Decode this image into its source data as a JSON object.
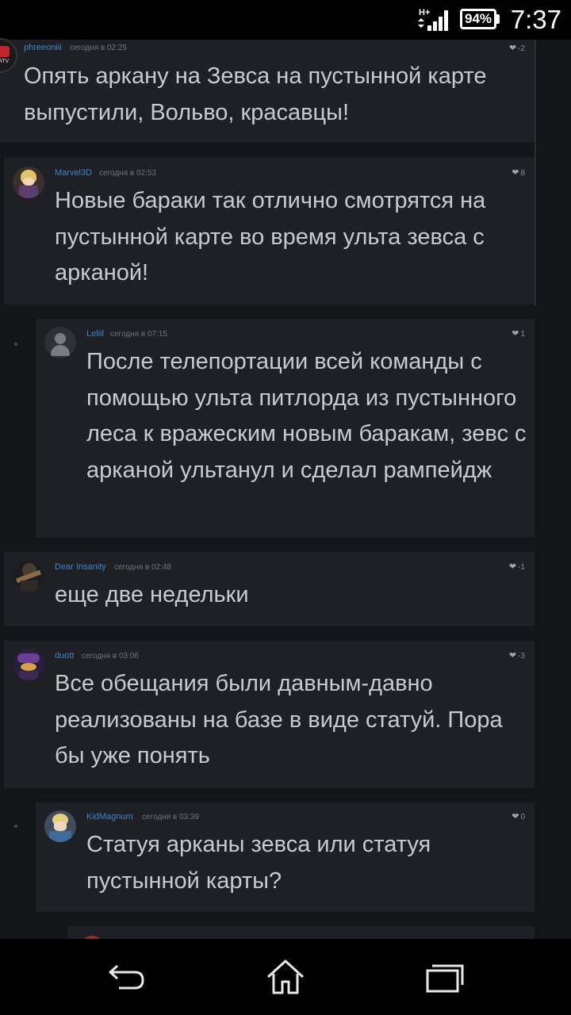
{
  "status_bar": {
    "network": "H+",
    "battery": "94%",
    "time": "7:37"
  },
  "comments": [
    {
      "author": "phreeoniii",
      "date": "сегодня в 02:25",
      "likes": "-2",
      "text": "Опять аркану на Зевса на пустынной карте выпустили, Вольво, красавцы!"
    },
    {
      "author": "Marvel3D",
      "date": "сегодня в 02:53",
      "likes": "8",
      "text": "Новые бараки так отлично смотрятся на пустынной карте во время ульта зевса с арканой!"
    },
    {
      "author": "Leliil",
      "date": "сегодня в 07:15",
      "likes": "1",
      "text": "После телепортации всей команды с помощью ульта питлорда из пустынного леса к вражеским новым баракам, зевс с арканой ультанул и сделал рампейдж"
    },
    {
      "author": "Dear Insanity",
      "date": "сегодня в 02:48",
      "likes": "-1",
      "text": "еще две недельки"
    },
    {
      "author": "duott",
      "date": "сегодня в 03:06",
      "likes": "-3",
      "text": "Все обещания были давным-давно реализованы на базе в виде статуй. Пора бы уже понять"
    },
    {
      "author": "KidMagnum",
      "date": "сегодня в 03:39",
      "likes": "0",
      "text": "Статуя арканы зевса или статуя пустынной карты?"
    }
  ],
  "icons": {
    "like": "heart-icon",
    "back": "back-arrow-icon",
    "home": "home-icon",
    "recents": "recent-apps-icon"
  },
  "colors": {
    "author": "#3b86c4",
    "card": "#1f2026",
    "background": "#141519"
  }
}
